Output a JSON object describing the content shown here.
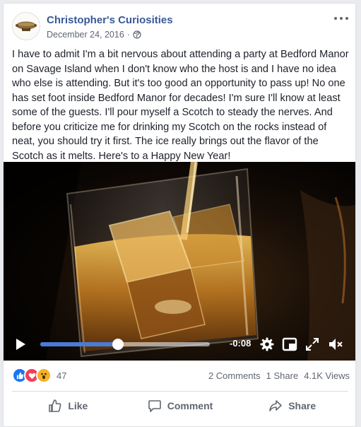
{
  "post": {
    "page_name": "Christopher's Curiosities",
    "date": "December 24, 2016",
    "privacy_icon": "globe-icon",
    "body": "I have to admit I'm a bit nervous about attending a party at Bedford Manor on Savage Island when I don't know who the host is and I have no idea who else is attending. But it's too good an opportunity to pass up! No one has set foot inside Bedford Manor for decades! I'm sure I'll know at least some of the guests. I'll pour myself a Scotch to steady the nerves. And before you criticize me for drinking my Scotch on the rocks instead of neat, you should try it first. The ice really brings out the flavor of the Scotch as it melts. Here's to a Happy New Year!"
  },
  "video": {
    "progress": 0.46,
    "time_remaining": "-0:08",
    "controls": [
      "play-icon",
      "settings-icon",
      "picture-in-picture-icon",
      "fullscreen-icon",
      "mute-icon"
    ]
  },
  "reactions": {
    "types": [
      "like",
      "love",
      "wow"
    ],
    "count": "47",
    "comments": "2 Comments",
    "shares": "1 Share",
    "views": "4.1K Views"
  },
  "actions": {
    "like": "Like",
    "comment": "Comment",
    "share": "Share"
  },
  "colors": {
    "page_link": "#385898",
    "like_blue": "#1877f2",
    "love_red": "#f33e58",
    "wow_yellow": "#f7b125",
    "progress": "#4a7bd6"
  }
}
